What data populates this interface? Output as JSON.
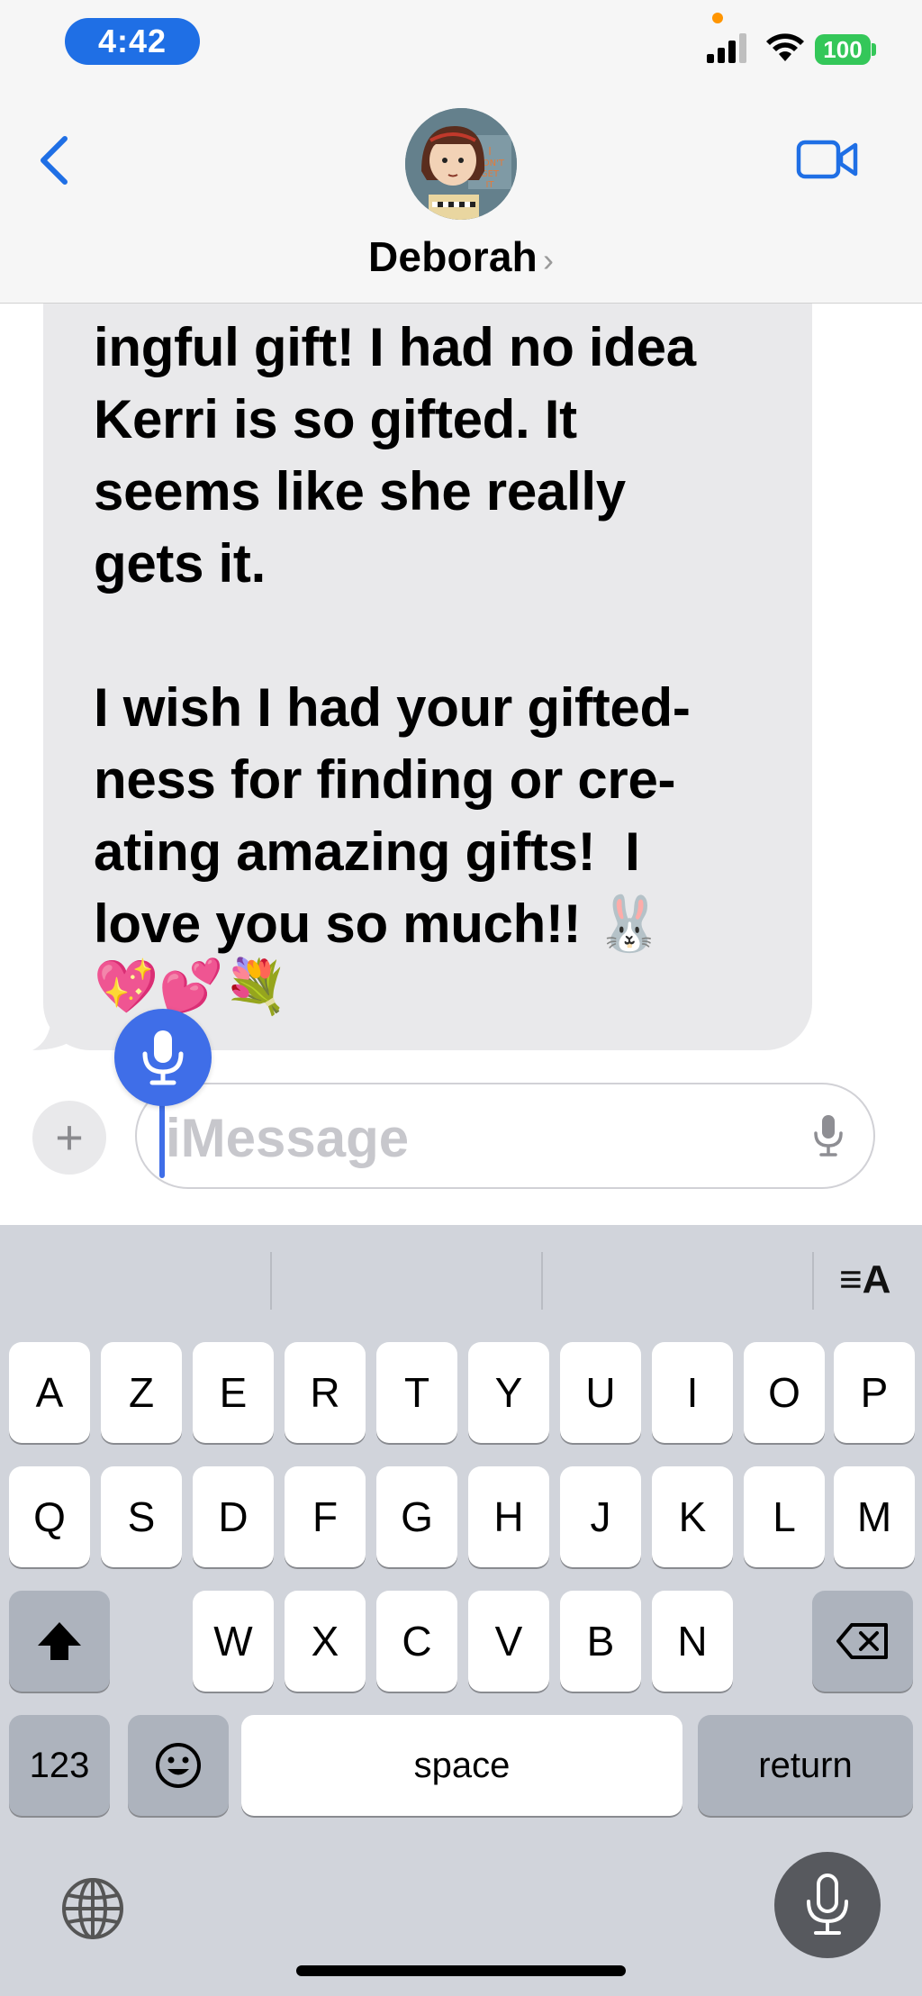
{
  "status_bar": {
    "time": "4:42",
    "battery": "100"
  },
  "header": {
    "contact_name": "Deborah",
    "chevron": "›",
    "back_icon": "chevron-left-icon",
    "video_icon": "video-camera-icon"
  },
  "message": {
    "text": "ingful gift! I had no idea\nKerri is so gifted. It\nseems like she really\ngets it.\n\nI wish I had your gifted-\nness for finding or cre-\nating amazing gifts!  I\nlove you so much!! 🐰",
    "emojis": "💖💕💐"
  },
  "input": {
    "placeholder": "iMessage",
    "plus_label": "+"
  },
  "keyboard": {
    "row1": [
      "A",
      "Z",
      "E",
      "R",
      "T",
      "Y",
      "U",
      "I",
      "O",
      "P"
    ],
    "row2": [
      "Q",
      "S",
      "D",
      "F",
      "G",
      "H",
      "J",
      "K",
      "L",
      "M"
    ],
    "row3": [
      "W",
      "X",
      "C",
      "V",
      "B",
      "N"
    ],
    "numbers_label": "123",
    "space_label": "space",
    "return_label": "return",
    "text_style_label": "≡A"
  },
  "colors": {
    "accent": "#1f6fe5",
    "dictation": "#3f6ee8",
    "battery": "#34c759",
    "bubble": "#e9e9eb",
    "keyboard_bg": "#d1d4db"
  }
}
